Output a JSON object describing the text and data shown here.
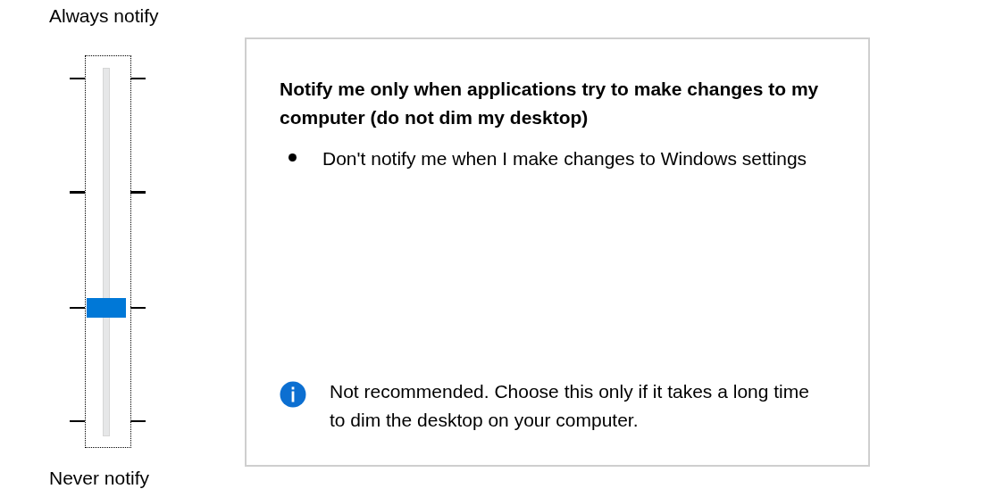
{
  "slider": {
    "top_label": "Always notify",
    "bottom_label": "Never notify",
    "level": 0.3333
  },
  "description": {
    "title": "Notify me only when applications try to make changes to my computer (do not dim my desktop)",
    "bullets": [
      "Don't notify me when I make changes to Windows settings"
    ],
    "note": "Not recommended. Choose this only if it takes a long time to dim the desktop on your computer."
  }
}
